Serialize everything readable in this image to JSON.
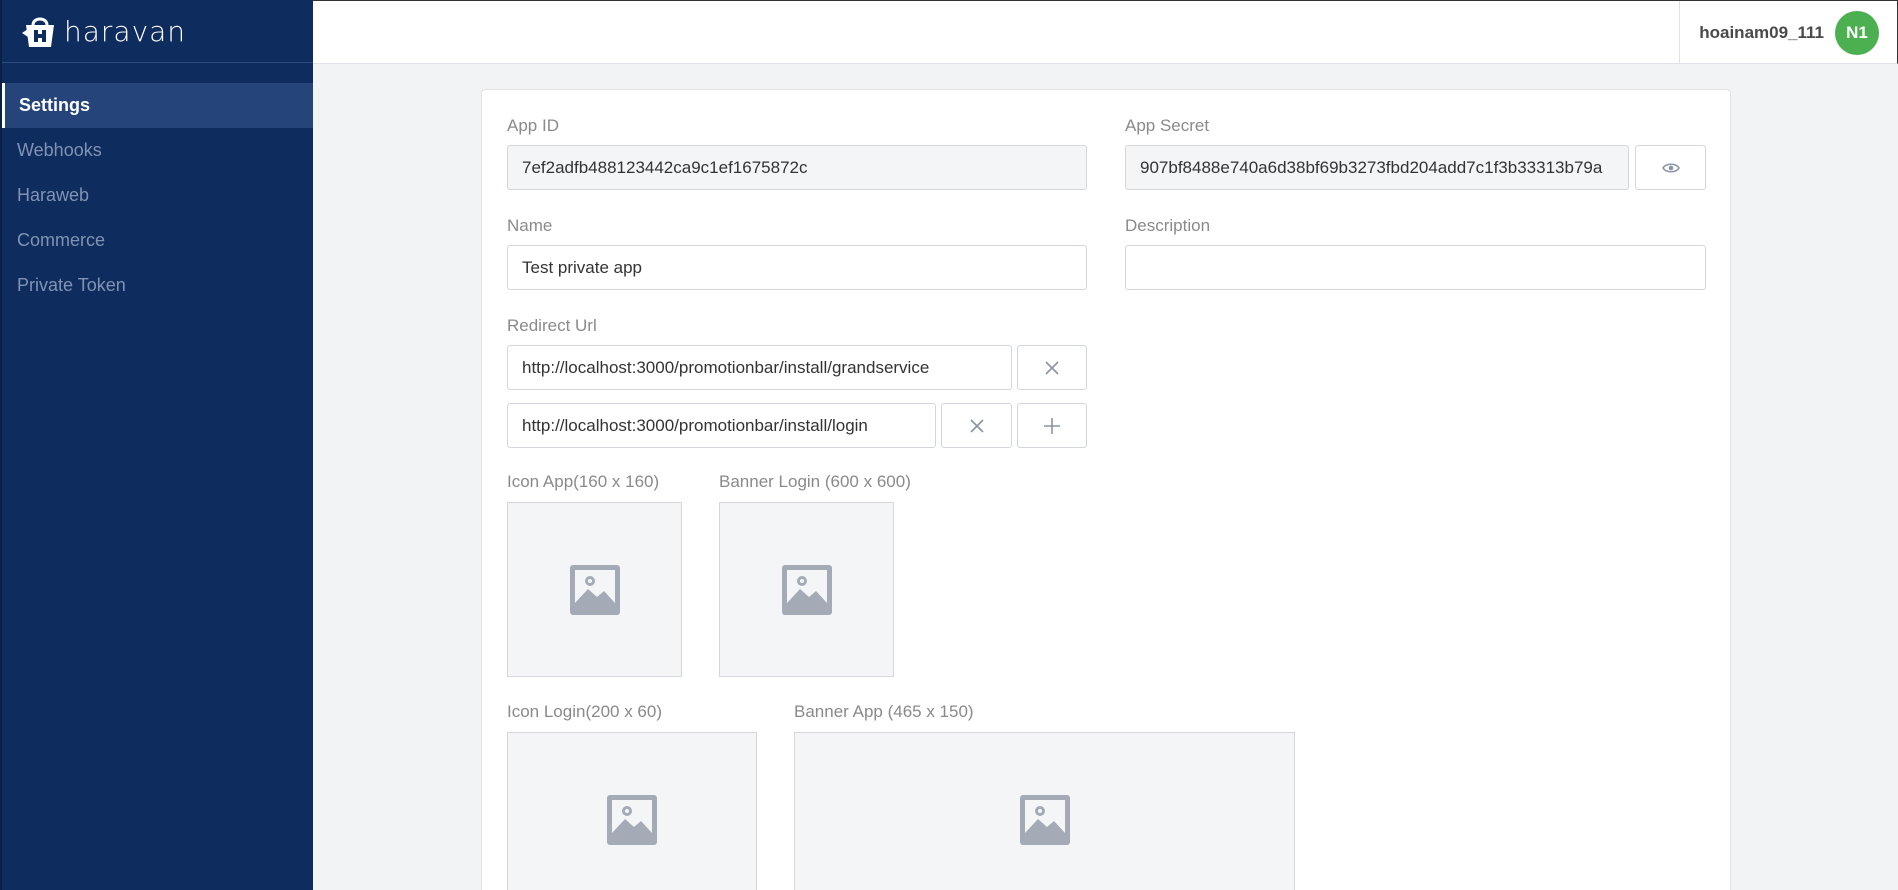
{
  "brand": {
    "name": "haravan"
  },
  "sidebar": {
    "items": [
      {
        "label": "Settings",
        "active": true
      },
      {
        "label": "Webhooks"
      },
      {
        "label": "Haraweb"
      },
      {
        "label": "Commerce"
      },
      {
        "label": "Private Token"
      }
    ]
  },
  "header": {
    "username": "hoainam09_111",
    "avatar_initials": "N1",
    "avatar_color": "#4caf50"
  },
  "form": {
    "app_id": {
      "label": "App ID",
      "value": "7ef2adfb488123442ca9c1ef1675872c"
    },
    "app_secret": {
      "label": "App Secret",
      "value": "907bf8488e740a6d38bf69b3273fbd204add7c1f3b33313b79a"
    },
    "name": {
      "label": "Name",
      "value": "Test private app"
    },
    "description": {
      "label": "Description",
      "value": ""
    },
    "redirect_url": {
      "label": "Redirect Url",
      "urls": [
        "http://localhost:3000/promotionbar/install/grandservice",
        "http://localhost:3000/promotionbar/install/login"
      ]
    },
    "images": {
      "icon_app": "Icon App(160 x 160)",
      "banner_login": "Banner Login (600 x 600)",
      "icon_login": "Icon Login(200 x 60)",
      "banner_app": "Banner App (465 x 150)"
    }
  },
  "colors": {
    "sidebar_bg": "#0f2c5e",
    "sidebar_active": "#24447a",
    "page_bg": "#f2f3f5"
  }
}
